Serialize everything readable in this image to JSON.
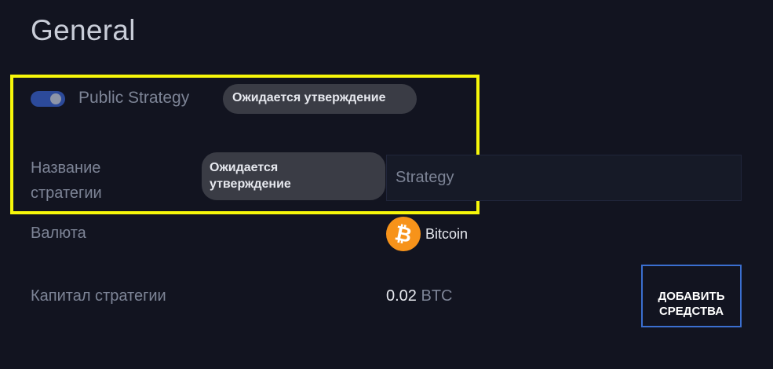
{
  "page": {
    "title": "General"
  },
  "public_strategy": {
    "label": "Public Strategy",
    "enabled": true,
    "status_badge": "Ожидается утверждение"
  },
  "strategy_name": {
    "label": "Название\nстратегии",
    "status_badge": "Ожидается\nутверждение",
    "placeholder": "Strategy"
  },
  "currency": {
    "label": "Валюта",
    "icon": "bitcoin-icon",
    "icon_glyph": "₿",
    "value": "Bitcoin",
    "icon_color": "#f7931a"
  },
  "capital": {
    "label": "Капитал стратегии",
    "amount": "0.02",
    "unit": "BTC",
    "add_funds_label": "ДОБАВИТЬ\nСРЕДСТВА"
  },
  "colors": {
    "background": "#121420",
    "highlight": "#f7f70a",
    "toggle_on": "#2c4a9a",
    "badge": "#3a3c45",
    "button_border": "#3b6fd0"
  }
}
